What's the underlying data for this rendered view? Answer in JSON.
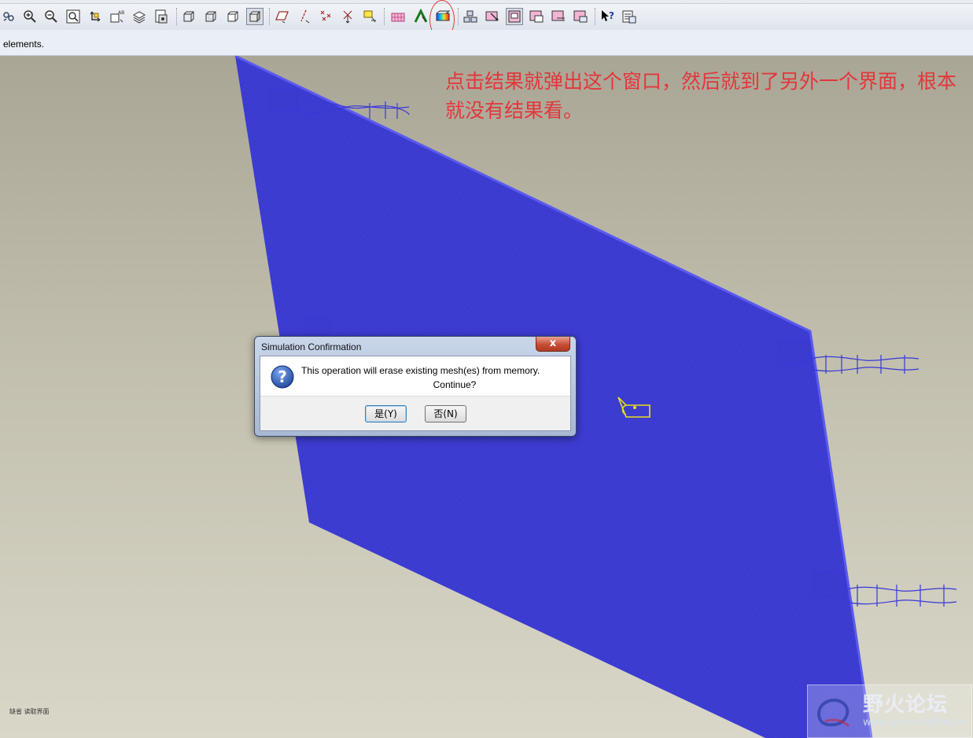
{
  "message_bar": {
    "text": "elements."
  },
  "annotation": {
    "text": "点击结果就弹出这个窗口，然后就到了另外一个界面，根本就没有结果看。"
  },
  "dialog": {
    "title": "Simulation Confirmation",
    "close_label": "x",
    "message_line1": "This operation will erase existing mesh(es) from memory.",
    "message_line2": "Continue?",
    "yes_label": "是(Y)",
    "no_label": "否(N)"
  },
  "corner_label": "缺省 读取界面",
  "watermark": {
    "title": "野火论坛",
    "url": "www.proewildfire.cn"
  },
  "colors": {
    "mesh": "#3d3dd6",
    "annotation": "#e3363b",
    "highlight": "#e23a3a",
    "cursor": "#e8e01a"
  },
  "toolbar": {
    "buttons": [
      {
        "name": "repaint-icon"
      },
      {
        "name": "zoom-in-icon"
      },
      {
        "name": "zoom-out-icon"
      },
      {
        "name": "refit-icon"
      },
      {
        "name": "reorient-icon"
      },
      {
        "name": "saved-view-icon"
      },
      {
        "name": "layers-icon"
      },
      {
        "name": "model-display-icon"
      },
      {
        "name": "wireframe-icon"
      },
      {
        "name": "hidden-line-icon"
      },
      {
        "name": "no-hidden-icon"
      },
      {
        "name": "shading-icon"
      },
      {
        "name": "datum-plane-icon"
      },
      {
        "name": "datum-axis-icon"
      },
      {
        "name": "datum-point-icon"
      },
      {
        "name": "coordinate-system-icon"
      },
      {
        "name": "annotation-display-icon"
      },
      {
        "name": "mesh-display-icon"
      },
      {
        "name": "analysis-run-icon"
      },
      {
        "name": "results-icon"
      },
      {
        "name": "simulation-display-icon"
      },
      {
        "name": "load-display-icon"
      },
      {
        "name": "constraint-display-icon"
      },
      {
        "name": "mesh-elements-icon"
      },
      {
        "name": "mesh-edges-icon"
      },
      {
        "name": "mesh-nodes-icon"
      },
      {
        "name": "help-context-icon"
      },
      {
        "name": "info-icon"
      }
    ]
  }
}
